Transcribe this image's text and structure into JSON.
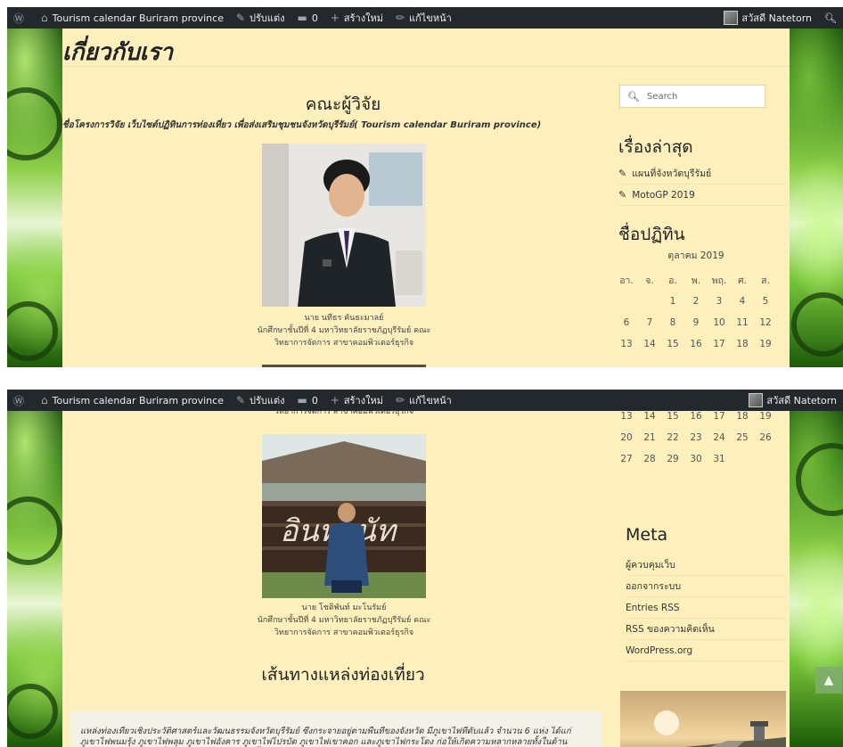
{
  "adminbar": {
    "site_name": "Tourism calendar Buriram province",
    "customize": "ปรับแต่ง",
    "comments_count": "0",
    "new": "สร้างใหม่",
    "edit_page": "แก้ไขหน้า",
    "greeting": "สวัสดี Natetorn"
  },
  "page": {
    "title": "เกี่ยวกับเรา",
    "researchers_heading": "คณะผู้วิจัย",
    "project_name": "ชื่อโครงการวิจัย เว็บไซต์ปฏิทินการท่องเที่ยว เพื่อส่งเสริมชุมชนจังหวัดบุรีรัมย์( Tourism calendar Buriram province)",
    "researcher1": {
      "name": "นาย นทีธร คันธะมาลย์",
      "line2": "นักศึกษาชั้นปีที่ 4 มหาวิทยาลัยราชภัฏบุรีรัมย์ คณะ",
      "line3": "วิทยาการจัดการ สาขาคอมพิวเตอร์ธุรกิจ"
    },
    "researcher2": {
      "name": "นาย โชติพันท์ มะโนรัมย์",
      "line2": "นักศึกษาชั้นปีที่ 4 มหาวิทยาลัยราชภัฏบุรีรัมย์ คณะ",
      "line3": "วิทยาการจัดการ สาขาคอมพิวเตอร์ธุรกิจ"
    },
    "route_heading": "เส้นทางแหล่งท่องเที่ยว",
    "route_text": "แหล่งท่องเที่ยวเชิงประวัติศาสตร์และวัฒนธรรมจังหวัดบุรีรัมย์ ซึ่งกระจายอยู่ตามพื้นที่ของจังหวัด มีภูเขาไฟที่ดับแล้ว จำนวน 6 แห่ง ได้แก่ ภูเขาไฟพนมรุ้ง ภูเขาไฟพลุม ภูเขาไฟอังคาร ภูเขาไฟไปรบัด ภูเขาไฟเขาคอก และภูเขาไฟกระโดง ก่อให้เกิดความหลากหลายทั้งในด้านภูมิศาสตร์ประกอบกันเรื่องราวทางประวัติศาสตร์ตั้งแต่ก่อนสมัยทวารวดี จนเกิดเป็นวัฒนธรรมบนเส้นทางแหล่งท่องเที่ยวที่สำคัญ"
  },
  "sidebar": {
    "search_placeholder": "Search",
    "recent_title": "เรื่องล่าสุด",
    "recent": [
      "แผนที่จังหวัดบุรีรัมย์",
      "MotoGP 2019"
    ],
    "calendar_title": "ชื่อปฏิทิน",
    "calendar_caption": "ตุลาคม 2019",
    "weekdays": [
      "อา.",
      "จ.",
      "อ.",
      "พ.",
      "พฤ.",
      "ศ.",
      "ส."
    ],
    "weeks": [
      [
        "",
        "",
        "1",
        "2",
        "3",
        "4",
        "5"
      ],
      [
        "6",
        "7",
        "8",
        "9",
        "10",
        "11",
        "12"
      ],
      [
        "13",
        "14",
        "15",
        "16",
        "17",
        "18",
        "19"
      ],
      [
        "20",
        "21",
        "22",
        "23",
        "24",
        "25",
        "26"
      ],
      [
        "27",
        "28",
        "29",
        "30",
        "31",
        "",
        ""
      ]
    ],
    "meta_title": "Meta",
    "meta": [
      "ผู้ควบคุมเว็บ",
      "ออกจากระบบ",
      "Entries RSS",
      "RSS ของความคิดเห็น",
      "WordPress.org"
    ]
  },
  "colors": {
    "content_bg": "#fdf0bd",
    "adminbar_bg": "#23282d",
    "page_bg": "#2f7a14"
  }
}
